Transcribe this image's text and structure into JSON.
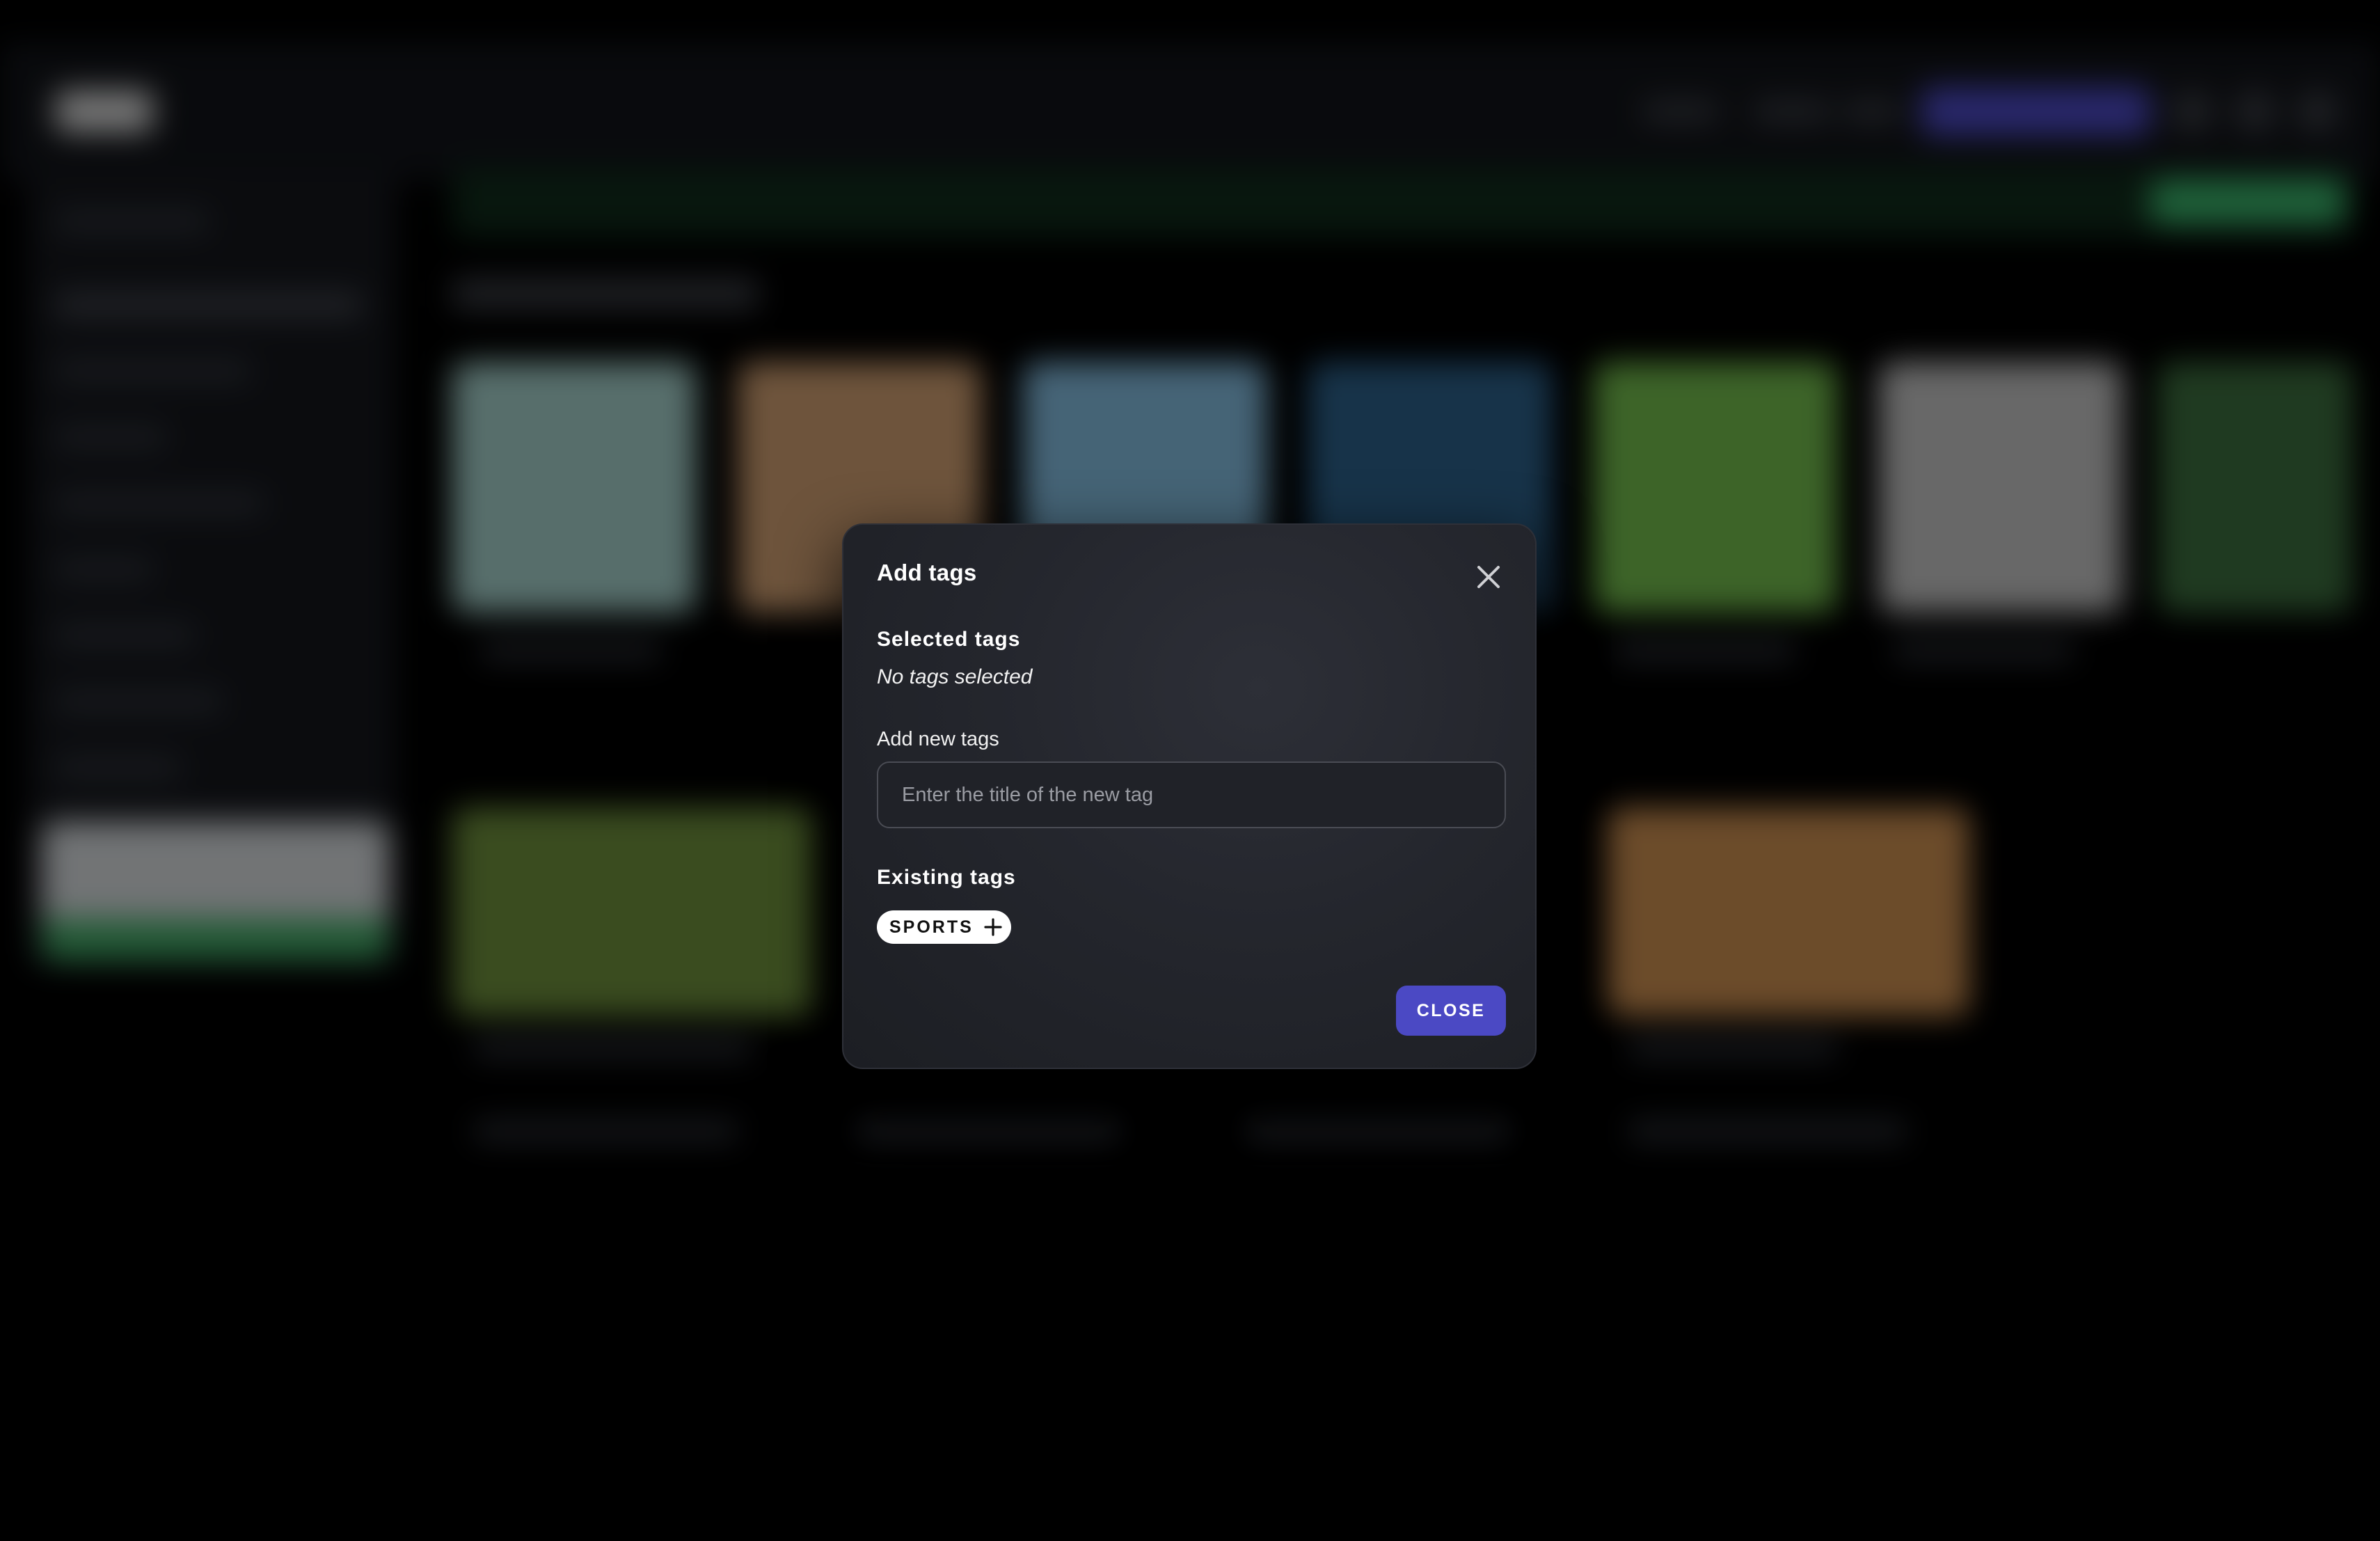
{
  "modal": {
    "title": "Add tags",
    "selected_heading": "Selected tags",
    "selected_empty": "No tags selected",
    "new_tag_label": "Add new tags",
    "new_tag_input": {
      "value": "",
      "placeholder": "Enter the title of the new tag"
    },
    "existing_heading": "Existing tags",
    "existing_tags": [
      {
        "label": "SPORTS",
        "icon": "plus-icon"
      }
    ],
    "close_button_label": "CLOSE",
    "close_icon": "close-icon"
  },
  "colors": {
    "accent": "#4b49c4",
    "modal_bg": "#24262d",
    "page_bg": "#000000",
    "chip_bg": "#ffffff"
  }
}
